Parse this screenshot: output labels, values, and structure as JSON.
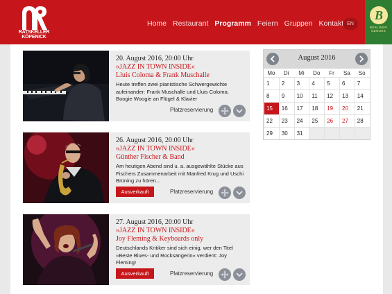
{
  "header": {
    "logo_text_line1": "RATSKELLER",
    "logo_text_line2": "KÖPENICK",
    "nav": [
      "Home",
      "Restaurant",
      "Programm",
      "Feiern",
      "Gruppen",
      "Kontakt"
    ],
    "active_nav": "Programm",
    "lang": "EN",
    "badge_letter": "B",
    "badge_line1": "BERLINER",
    "badge_line2": "GENUSS",
    "brand_color": "#c7161b"
  },
  "events": [
    {
      "date": "20. August 2016, 20:00 Uhr",
      "title_line1": "»JAZZ IN TOWN INSIDE«",
      "title_line2": "Lluis Coloma & Frank Muschalle",
      "text": "Heute treffen zwei pianistische Schwergewichte aufeinander: Frank Muschalle und Lluis Coloma. Boogie Woogie an Flügel & Klavier",
      "sold_out": "",
      "reserve": "Platzreservierung"
    },
    {
      "date": "26. August 2016, 20:00 Uhr",
      "title_line1": "»JAZZ IN TOWN INSIDE«",
      "title_line2": "Günther Fischer & Band",
      "text": "Am heutigen Abend sind u. a. ausgewählte Stücke aus Fischers Zusammenarbeit mit Manfred Krug und Uschi Brüning zu hören...",
      "sold_out": "Ausverkauft",
      "reserve": "Platzreservierung"
    },
    {
      "date": "27. August 2016, 20:00 Uhr",
      "title_line1": "»JAZZ IN TOWN INSIDE«",
      "title_line2": "Joy Fleming & Keyboards only",
      "text": "Deutschlands Kritiker sind sich einig, wer den Titel »Beste Blues- und Rocksängerin« verdient: Joy Fleming!",
      "sold_out": "Ausverkauft",
      "reserve": "Platzreservierung"
    }
  ],
  "calendar": {
    "title": "August 2016",
    "weekdays": [
      "Mo",
      "Di",
      "Mi",
      "Do",
      "Fr",
      "Sa",
      "So"
    ],
    "weeks": [
      [
        "1",
        "2",
        "3",
        "4",
        "5",
        "6",
        "7"
      ],
      [
        "8",
        "9",
        "10",
        "11",
        "12",
        "13",
        "14"
      ],
      [
        "15",
        "16",
        "17",
        "18",
        "19",
        "20",
        "21"
      ],
      [
        "22",
        "23",
        "24",
        "25",
        "26",
        "27",
        "28"
      ],
      [
        "29",
        "30",
        "31",
        "",
        "",
        "",
        ""
      ]
    ],
    "today": "15",
    "event_days": [
      "19",
      "20",
      "26",
      "27"
    ]
  }
}
